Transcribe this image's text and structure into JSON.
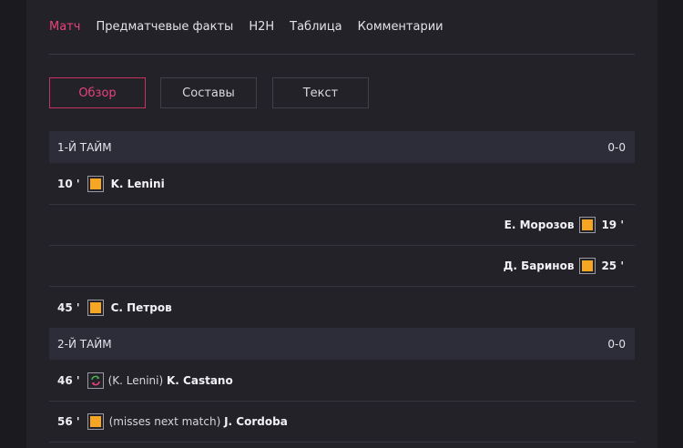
{
  "nav": {
    "tabs": [
      "Матч",
      "Предматчевые факты",
      "H2H",
      "Таблица",
      "Комментарии"
    ]
  },
  "buttons": {
    "overview": "Обзор",
    "lineups": "Составы",
    "text": "Текст"
  },
  "periods": [
    {
      "label": "1-Й ТАЙМ",
      "score": "0-0"
    },
    {
      "label": "2-Й ТАЙМ",
      "score": "0-0"
    }
  ],
  "events": [
    {
      "minute": "10 '",
      "player": "K. Lenini",
      "icon": "yellow-card",
      "side": "home"
    },
    {
      "minute": "19 '",
      "player": "Е. Морозов",
      "icon": "yellow-card",
      "side": "away"
    },
    {
      "minute": "25 '",
      "player": "Д. Баринов",
      "icon": "yellow-card",
      "side": "away"
    },
    {
      "minute": "45 '",
      "player": "С. Петров",
      "icon": "yellow-card",
      "side": "home"
    },
    {
      "minute": "46 '",
      "note": "(K. Lenini)",
      "player": "K. Castano",
      "icon": "substitution",
      "side": "home"
    },
    {
      "minute": "56 '",
      "note": "(misses next match)",
      "player": "J. Cordoba",
      "icon": "yellow-card",
      "side": "home"
    }
  ],
  "colors": {
    "accent": "#e8437a",
    "yellow_card": "#f7a623",
    "panel": "#222228",
    "period_bar": "#2c2d38"
  }
}
